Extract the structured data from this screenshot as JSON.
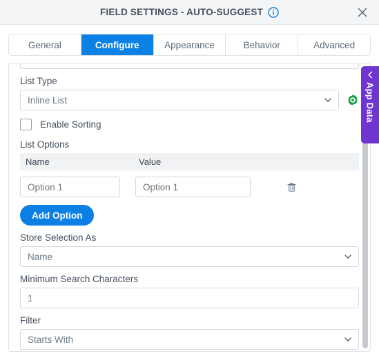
{
  "titlebar": {
    "title": "FIELD SETTINGS - AUTO-SUGGEST",
    "info_icon": "info-circle-icon",
    "close_icon": "close-icon"
  },
  "tabs": [
    {
      "label": "General",
      "active": false
    },
    {
      "label": "Configure",
      "active": true
    },
    {
      "label": "Appearance",
      "active": false
    },
    {
      "label": "Behavior",
      "active": false
    },
    {
      "label": "Advanced",
      "active": false
    }
  ],
  "form": {
    "list_type": {
      "label": "List Type",
      "value": "Inline List",
      "options": [
        "Inline List"
      ],
      "gear_icon": "gear-icon"
    },
    "enable_sorting": {
      "label": "Enable Sorting",
      "checked": false
    },
    "list_options": {
      "label": "List Options",
      "columns": [
        "Name",
        "Value"
      ],
      "rows": [
        {
          "name_placeholder": "Option 1",
          "value_placeholder": "Option 1",
          "delete_icon": "trash-icon"
        }
      ],
      "add_button": "Add Option"
    },
    "store_selection_as": {
      "label": "Store Selection As",
      "value": "Name",
      "options": [
        "Name"
      ]
    },
    "minimum_search_characters": {
      "label": "Minimum Search Characters",
      "value": "1"
    },
    "filter": {
      "label": "Filter",
      "value": "Starts With",
      "options": [
        "Starts With"
      ]
    }
  },
  "side_panel": {
    "label": "App Data",
    "collapse_icon": "chevron-left-icon"
  },
  "colors": {
    "accent_blue": "#0b80e5",
    "purple": "#6f35d0",
    "green": "#1e9e4a"
  }
}
